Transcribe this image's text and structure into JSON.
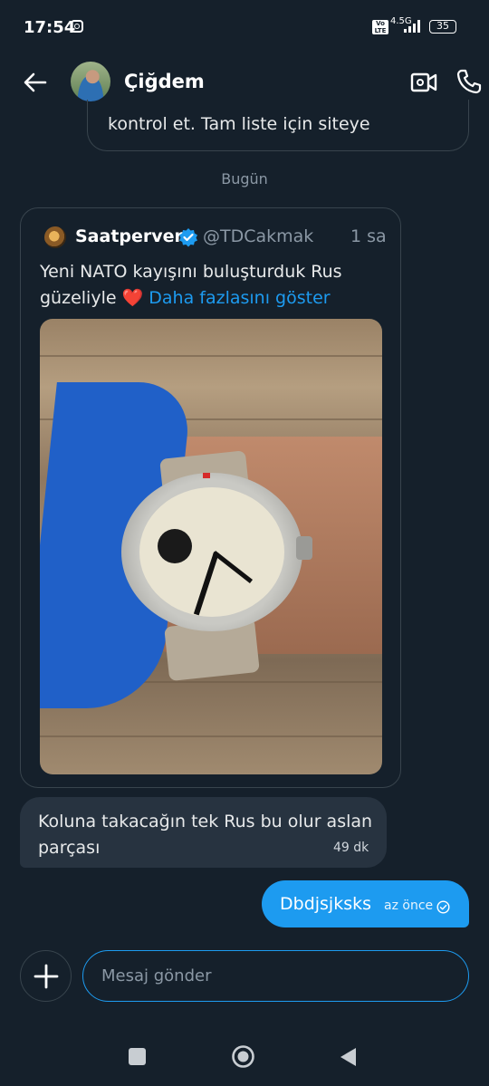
{
  "status_bar": {
    "time": "17:54",
    "network": "4.5G",
    "volte": "Vo LTE",
    "battery": "35"
  },
  "header": {
    "contact_name": "Çiğdem",
    "back_icon": "arrow-left-icon",
    "video_icon": "video-camera-icon",
    "phone_icon": "phone-icon"
  },
  "conversation": {
    "previous_message_fragment": "kontrol et. Tam liste için siteye",
    "day_separator": "Bugün",
    "shared_tweet": {
      "author_name": "Saatperver",
      "author_handle": "@TDCakmak",
      "time": "1 sa",
      "text": "Yeni NATO kayışını buluşturduk Rus güzeliyle ❤️",
      "more_link": "Daha fazlasını göster",
      "verified": true
    },
    "incoming_message": {
      "text": "Koluna takacağın tek Rus bu olur aslan parçası",
      "time": "49 dk"
    },
    "outgoing_message": {
      "text": "Dbdjsjksks",
      "time": "az önce"
    }
  },
  "composer": {
    "placeholder": "Mesaj gönder"
  },
  "colors": {
    "background": "#15202b",
    "accent": "#1d9bf0",
    "incoming_bubble": "#273340",
    "border": "#38444d",
    "muted_text": "#8b98a5"
  }
}
